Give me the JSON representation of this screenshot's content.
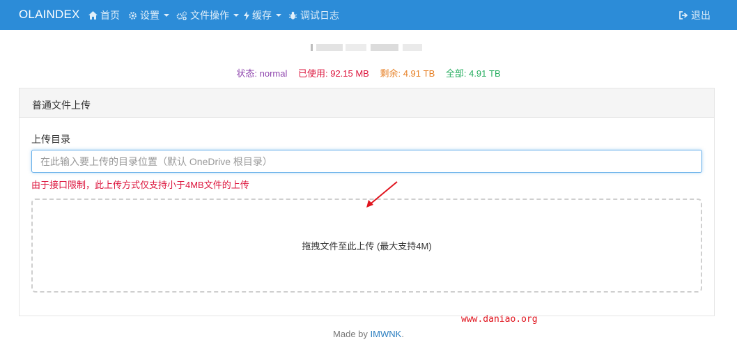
{
  "navbar": {
    "brand": "OLAINDEX",
    "home": "首页",
    "settings": "设置",
    "file_ops": "文件操作",
    "cache": "缓存",
    "debug_log": "调试日志",
    "logout": "退出"
  },
  "stats": {
    "status": "状态: normal",
    "used": "已使用: 92.15 MB",
    "remaining": "剩余: 4.91 TB",
    "total": "全部: 4.91 TB"
  },
  "panel": {
    "title": "普通文件上传",
    "dir_label": "上传目录",
    "dir_placeholder": "在此输入要上传的目录位置（默认 OneDrive 根目录）",
    "warning": "由于接口限制，此上传方式仅支持小于4MB文件的上传",
    "dropzone_text": "拖拽文件至此上传 (最大支持4M)"
  },
  "footer": {
    "made_by": "Made by ",
    "author": "IMWNK",
    "suffix": "."
  },
  "watermark": "www.daniao.org",
  "colors": {
    "navbar_bg": "#2c8cd8",
    "status": "#8e44ad",
    "used": "#dc143c",
    "remaining": "#e67e22",
    "total": "#27ae60",
    "warning": "#dc143c"
  },
  "icons": [
    "home-icon",
    "gear-icon",
    "cogs-icon",
    "bolt-icon",
    "bug-icon",
    "sign-out-icon"
  ]
}
